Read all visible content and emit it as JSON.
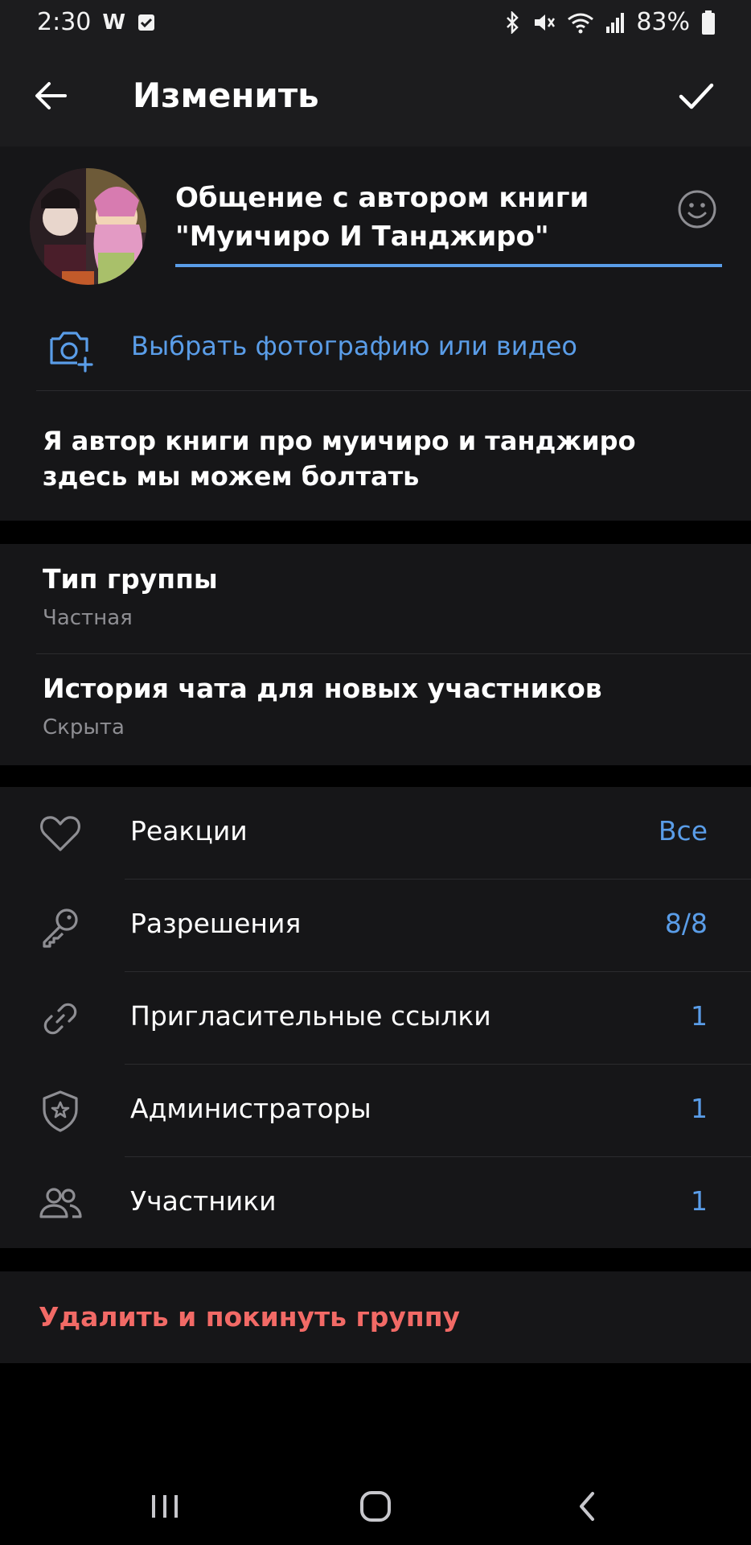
{
  "status_bar": {
    "time": "2:30",
    "battery": "83%",
    "icons": [
      "w-app-icon",
      "checkbox-notification-icon",
      "bluetooth-icon",
      "vibrate-mute-icon",
      "wifi-icon",
      "signal-icon",
      "battery-icon"
    ]
  },
  "app_bar": {
    "title": "Изменить",
    "back_icon": "arrow-left-icon",
    "confirm_icon": "checkmark-icon"
  },
  "group": {
    "name_line1": "Общение с автором книги",
    "name_line2": "\"Муичиро И Танджиро\"",
    "choose_media": "Выбрать фотографию или видео",
    "description": "Я автор книги про муичиро и танджиро здесь мы можем болтать"
  },
  "group_info": [
    {
      "title": "Тип группы",
      "subtitle": "Частная"
    },
    {
      "title": "История чата для новых участников",
      "subtitle": "Скрыта"
    }
  ],
  "settings": [
    {
      "icon": "heart-icon",
      "label": "Реакции",
      "value": "Все"
    },
    {
      "icon": "key-icon",
      "label": "Разрешения",
      "value": "8/8"
    },
    {
      "icon": "link-icon",
      "label": "Пригласительные ссылки",
      "value": "1"
    },
    {
      "icon": "shield-star-icon",
      "label": "Администраторы",
      "value": "1"
    },
    {
      "icon": "users-icon",
      "label": "Участники",
      "value": "1"
    }
  ],
  "delete_label": "Удалить и покинуть группу",
  "colors": {
    "accent": "#5a9de8",
    "danger": "#f26a66",
    "panel": "#161618",
    "header": "#1c1c1e"
  },
  "nav_icons": [
    "recent-apps-icon",
    "home-icon",
    "back-nav-icon"
  ]
}
